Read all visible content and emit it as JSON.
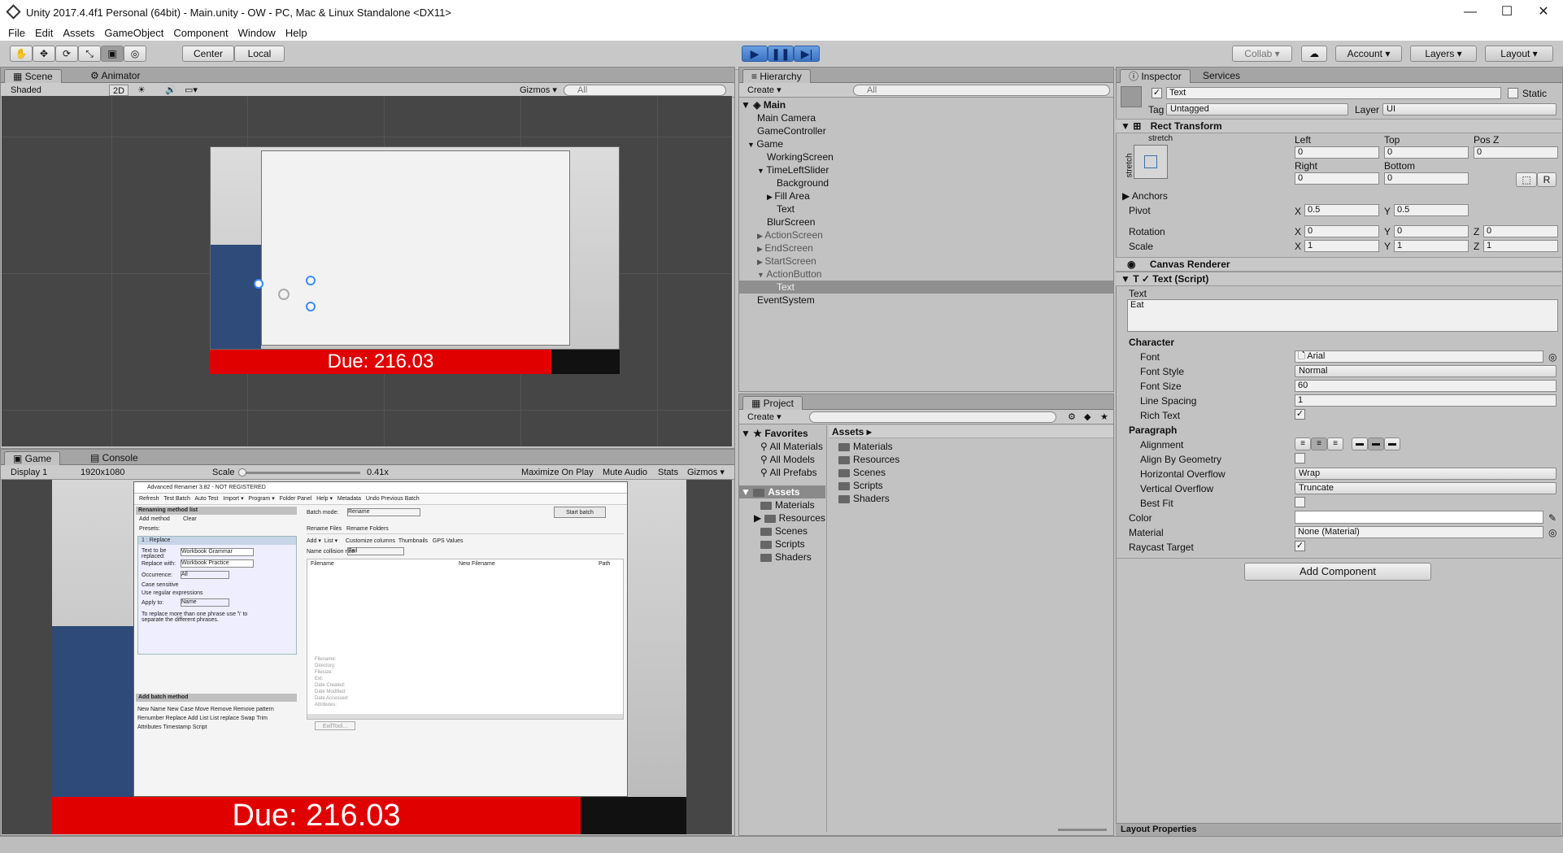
{
  "window": {
    "title": "Unity 2017.4.4f1 Personal (64bit) - Main.unity - OW - PC, Mac & Linux Standalone <DX11>",
    "minimize": "—",
    "maximize": "☐",
    "close": "✕"
  },
  "menu": [
    "File",
    "Edit",
    "Assets",
    "GameObject",
    "Component",
    "Window",
    "Help"
  ],
  "toolbar": {
    "center": "Center",
    "local": "Local",
    "collab": "Collab ▾",
    "account": "Account ▾",
    "layers": "Layers ▾",
    "layout": "Layout ▾",
    "play": "▶",
    "pause": "❚❚",
    "step": "▶|"
  },
  "scene": {
    "tab_scene": "Scene",
    "tab_animator": "Animator",
    "shaded": "Shaded",
    "mode2d": "2D",
    "gizmos": "Gizmos ▾",
    "search": "All",
    "due": "Due: 216.03"
  },
  "game": {
    "tab_game": "Game",
    "tab_console": "Console",
    "display": "Display 1",
    "resolution": "1920x1080",
    "scale_label": "Scale",
    "scale_value": "0.41x",
    "maximize": "Maximize On Play",
    "mute": "Mute Audio",
    "stats": "Stats",
    "gizmos": "Gizmos ▾",
    "due": "Due: 216.03"
  },
  "embedded": {
    "title": "Advanced Renamer 3.82 - NOT REGISTERED",
    "toolbar": [
      "Refresh",
      "Test Batch",
      "Auto Test",
      "Import ▾",
      "Program ▾",
      "Folder Panel",
      "Help ▾",
      "Metadata",
      "Undo Previous Batch"
    ],
    "methods": "Renaming method list",
    "add_method": "Add method",
    "clear": "Clear",
    "presets": "Presets:",
    "replace": "1 : Replace",
    "text_replace": "Text to be replaced:",
    "replace_with": "Replace with:",
    "val_replace": "Workbook Grammar",
    "val_with": "Workbook Practice",
    "occurrence": "Occurrence:",
    "occ_val": "All",
    "case": "Case sensitive",
    "regex": "Use regular expressions",
    "apply": "Apply to:",
    "apply_val": "Name",
    "hint": "To replace more than one phrase use '\\' to separate the different phrases.",
    "batch_mode": "Batch mode:",
    "batch_val": "Rename",
    "start": "Start batch",
    "rename_files": "Rename Files",
    "rename_folders": "Rename Folders",
    "add": "Add ▾",
    "list": "List ▾",
    "customize": "Customize columns",
    "thumbs": "Thumbnails",
    "gps": "GPS Values",
    "collision": "Name collision rule:",
    "collision_val": "Fail",
    "col_filename": "Filename",
    "col_new": "New Filename",
    "col_path": "Path",
    "add_batch": "Add batch method",
    "batch_methods": [
      "New Name",
      "New Case",
      "Move",
      "Remove",
      "Remove pattern",
      "Renumber",
      "Replace",
      "Add",
      "List",
      "List replace",
      "Swap",
      "Trim",
      "Attributes",
      "Timestamp",
      "Script"
    ],
    "details": [
      "Filename:",
      "Directory:",
      "Filesize:",
      "Ext:",
      "Date Created:",
      "Date Modified:",
      "Date Accessed:",
      "Attributes:"
    ],
    "exifbtn": "ExifTool..."
  },
  "hierarchy": {
    "tab": "Hierarchy",
    "create": "Create ▾",
    "search": "All",
    "scene": "Main",
    "items": [
      {
        "label": "Main Camera",
        "depth": 1,
        "arrow": "",
        "grey": false,
        "sel": false
      },
      {
        "label": "GameController",
        "depth": 1,
        "arrow": "",
        "grey": false,
        "sel": false
      },
      {
        "label": "Game",
        "depth": 1,
        "arrow": "▼",
        "grey": false,
        "sel": false
      },
      {
        "label": "WorkingScreen",
        "depth": 2,
        "arrow": "",
        "grey": false,
        "sel": false
      },
      {
        "label": "TimeLeftSlider",
        "depth": 2,
        "arrow": "▼",
        "grey": false,
        "sel": false
      },
      {
        "label": "Background",
        "depth": 3,
        "arrow": "",
        "grey": false,
        "sel": false
      },
      {
        "label": "Fill Area",
        "depth": 3,
        "arrow": "▶",
        "grey": false,
        "sel": false
      },
      {
        "label": "Text",
        "depth": 3,
        "arrow": "",
        "grey": false,
        "sel": false
      },
      {
        "label": "BlurScreen",
        "depth": 2,
        "arrow": "",
        "grey": false,
        "sel": false
      },
      {
        "label": "ActionScreen",
        "depth": 2,
        "arrow": "▶",
        "grey": true,
        "sel": false
      },
      {
        "label": "EndScreen",
        "depth": 2,
        "arrow": "▶",
        "grey": true,
        "sel": false
      },
      {
        "label": "StartScreen",
        "depth": 2,
        "arrow": "▶",
        "grey": true,
        "sel": false
      },
      {
        "label": "ActionButton",
        "depth": 2,
        "arrow": "▼",
        "grey": true,
        "sel": false
      },
      {
        "label": "Text",
        "depth": 3,
        "arrow": "",
        "grey": true,
        "sel": true
      },
      {
        "label": "EventSystem",
        "depth": 1,
        "arrow": "",
        "grey": false,
        "sel": false
      }
    ]
  },
  "project": {
    "tab": "Project",
    "create": "Create ▾",
    "favorites": "Favorites",
    "fav_items": [
      "All Materials",
      "All Models",
      "All Prefabs"
    ],
    "assets": "Assets",
    "tree": [
      "Materials",
      "Resources",
      "Scenes",
      "Scripts",
      "Shaders"
    ],
    "breadcrumb": "Assets ▸",
    "contents": [
      "Materials",
      "Resources",
      "Scenes",
      "Scripts",
      "Shaders"
    ]
  },
  "inspector": {
    "tab": "Inspector",
    "tab_services": "Services",
    "name": "Text",
    "static": "Static",
    "tag_label": "Tag",
    "tag": "Untagged",
    "layer_label": "Layer",
    "layer": "UI",
    "rect": "Rect Transform",
    "stretch": "stretch",
    "left": "Left",
    "top": "Top",
    "posz": "Pos Z",
    "left_v": "0",
    "top_v": "0",
    "posz_v": "0",
    "right": "Right",
    "bottom": "Bottom",
    "right_v": "0",
    "bottom_v": "0",
    "r_btn": "R",
    "anchors": "Anchors",
    "pivot": "Pivot",
    "pivot_x": "0.5",
    "pivot_y": "0.5",
    "rotation": "Rotation",
    "rot_x": "0",
    "rot_y": "0",
    "rot_z": "0",
    "scale": "Scale",
    "sc_x": "1",
    "sc_y": "1",
    "sc_z": "1",
    "x": "X",
    "y": "Y",
    "z": "Z",
    "canvas_renderer": "Canvas Renderer",
    "text_script": "Text (Script)",
    "text_label": "Text",
    "text_value": "Eat",
    "character": "Character",
    "font": "Font",
    "font_v": "Arial",
    "font_style": "Font Style",
    "font_style_v": "Normal",
    "font_size": "Font Size",
    "font_size_v": "60",
    "line_spacing": "Line Spacing",
    "line_spacing_v": "1",
    "rich_text": "Rich Text",
    "paragraph": "Paragraph",
    "alignment": "Alignment",
    "align_geom": "Align By Geometry",
    "h_overflow": "Horizontal Overflow",
    "h_overflow_v": "Wrap",
    "v_overflow": "Vertical Overflow",
    "v_overflow_v": "Truncate",
    "best_fit": "Best Fit",
    "color": "Color",
    "material": "Material",
    "material_v": "None (Material)",
    "raycast": "Raycast Target",
    "add_component": "Add Component",
    "layout_props": "Layout Properties"
  }
}
